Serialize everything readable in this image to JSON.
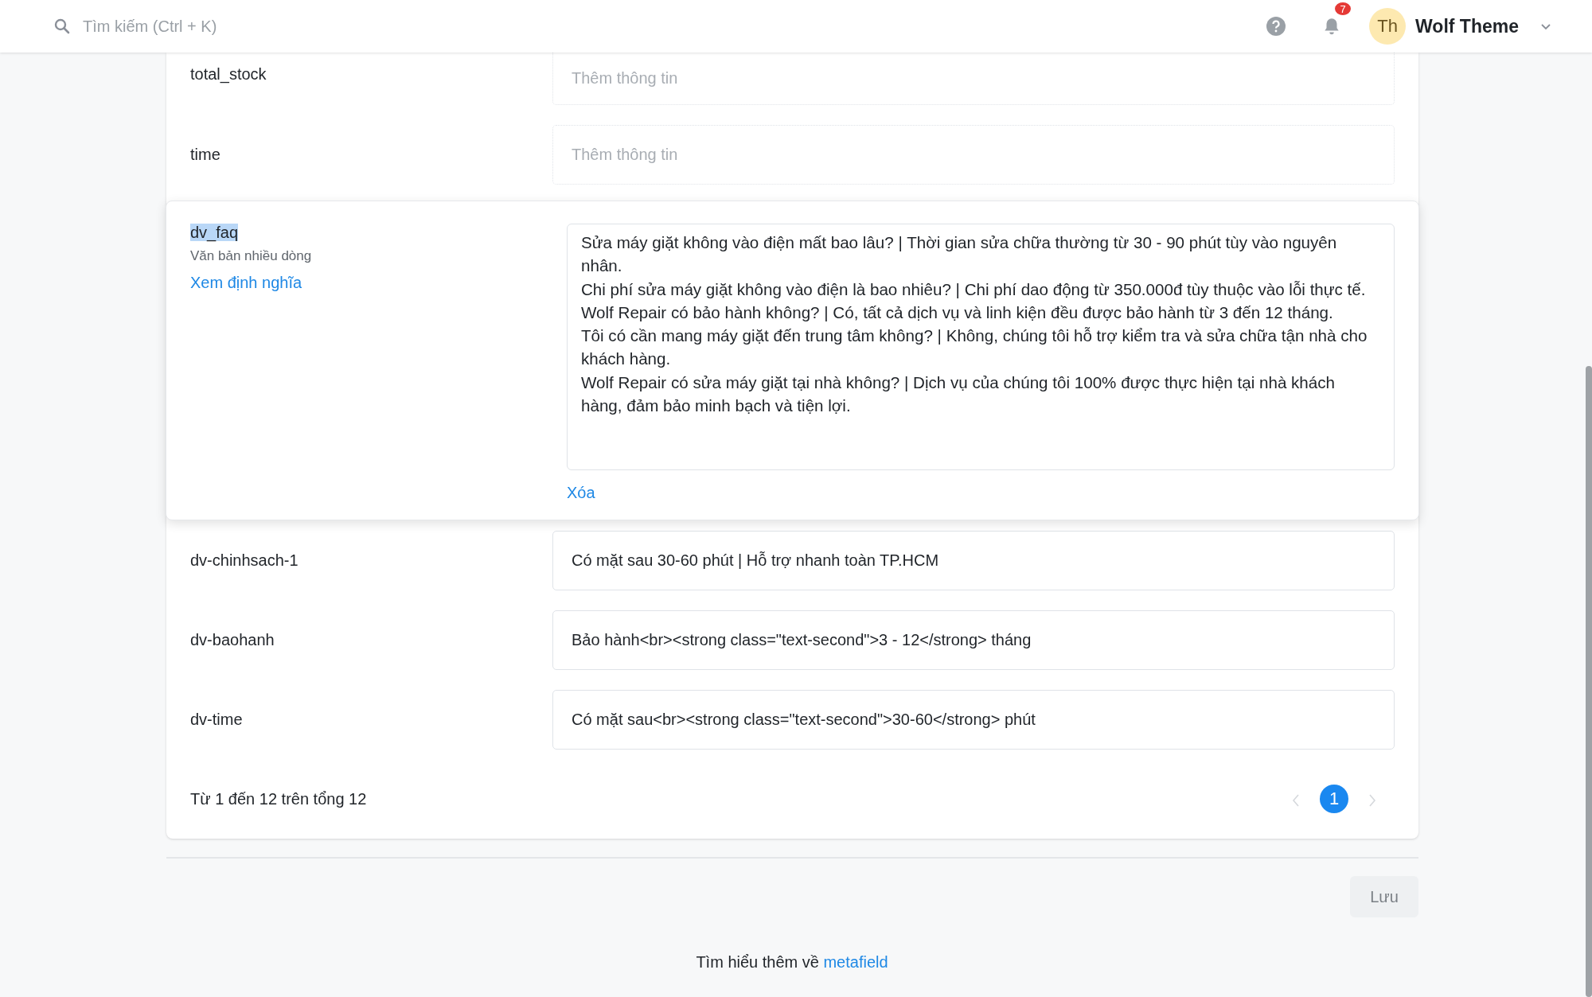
{
  "header": {
    "search_placeholder": "Tìm kiếm (Ctrl + K)",
    "notification_count": "7",
    "avatar_initials": "Th",
    "user_name": "Wolf Theme"
  },
  "fields": [
    {
      "kind": "single",
      "name": "total_stock",
      "placeholder": "Thêm thông tin"
    },
    {
      "kind": "single",
      "name": "time",
      "placeholder": "Thêm thông tin"
    },
    {
      "kind": "multiline",
      "name": "dv_faq",
      "name_selected": true,
      "type_label": "Văn bản nhiều dòng",
      "definition_link": "Xem định nghĩa",
      "value": "Sửa máy giặt không vào điện mất bao lâu? | Thời gian sửa chữa thường từ 30 - 90 phút tùy vào nguyên nhân.\nChi phí sửa máy giặt không vào điện là bao nhiêu? | Chi phí dao động từ 350.000đ tùy thuộc vào lỗi thực tế.\nWolf Repair có bảo hành không? | Có, tất cả dịch vụ và linh kiện đều được bảo hành từ 3 đến 12 tháng.\nTôi có cần mang máy giặt đến trung tâm không? | Không, chúng tôi hỗ trợ kiểm tra và sửa chữa tận nhà cho khách hàng.\nWolf Repair có sửa máy giặt tại nhà không? | Dịch vụ của chúng tôi 100% được thực hiện tại nhà khách hàng, đảm bảo minh bạch và tiện lợi.",
      "delete_link": "Xóa"
    },
    {
      "kind": "single",
      "name": "dv-chinhsach-1",
      "value": "Có mặt sau 30-60 phút | Hỗ trợ nhanh toàn TP.HCM"
    },
    {
      "kind": "single",
      "name": "dv-baohanh",
      "value": "Bảo hành<br><strong class=\"text-second\">3 - 12</strong> tháng"
    },
    {
      "kind": "single",
      "name": "dv-time",
      "value": "Có mặt sau<br><strong class=\"text-second\">30-60</strong> phút"
    }
  ],
  "pagination": {
    "summary": "Từ 1 đến 12 trên tổng 12",
    "prev_disabled": true,
    "next_disabled": true,
    "pages": [
      {
        "label": "1",
        "selected": true
      }
    ]
  },
  "save_button": {
    "label": "Lưu",
    "disabled": true
  },
  "footer": {
    "text": "Tìm hiểu thêm về",
    "link": "metafield"
  }
}
